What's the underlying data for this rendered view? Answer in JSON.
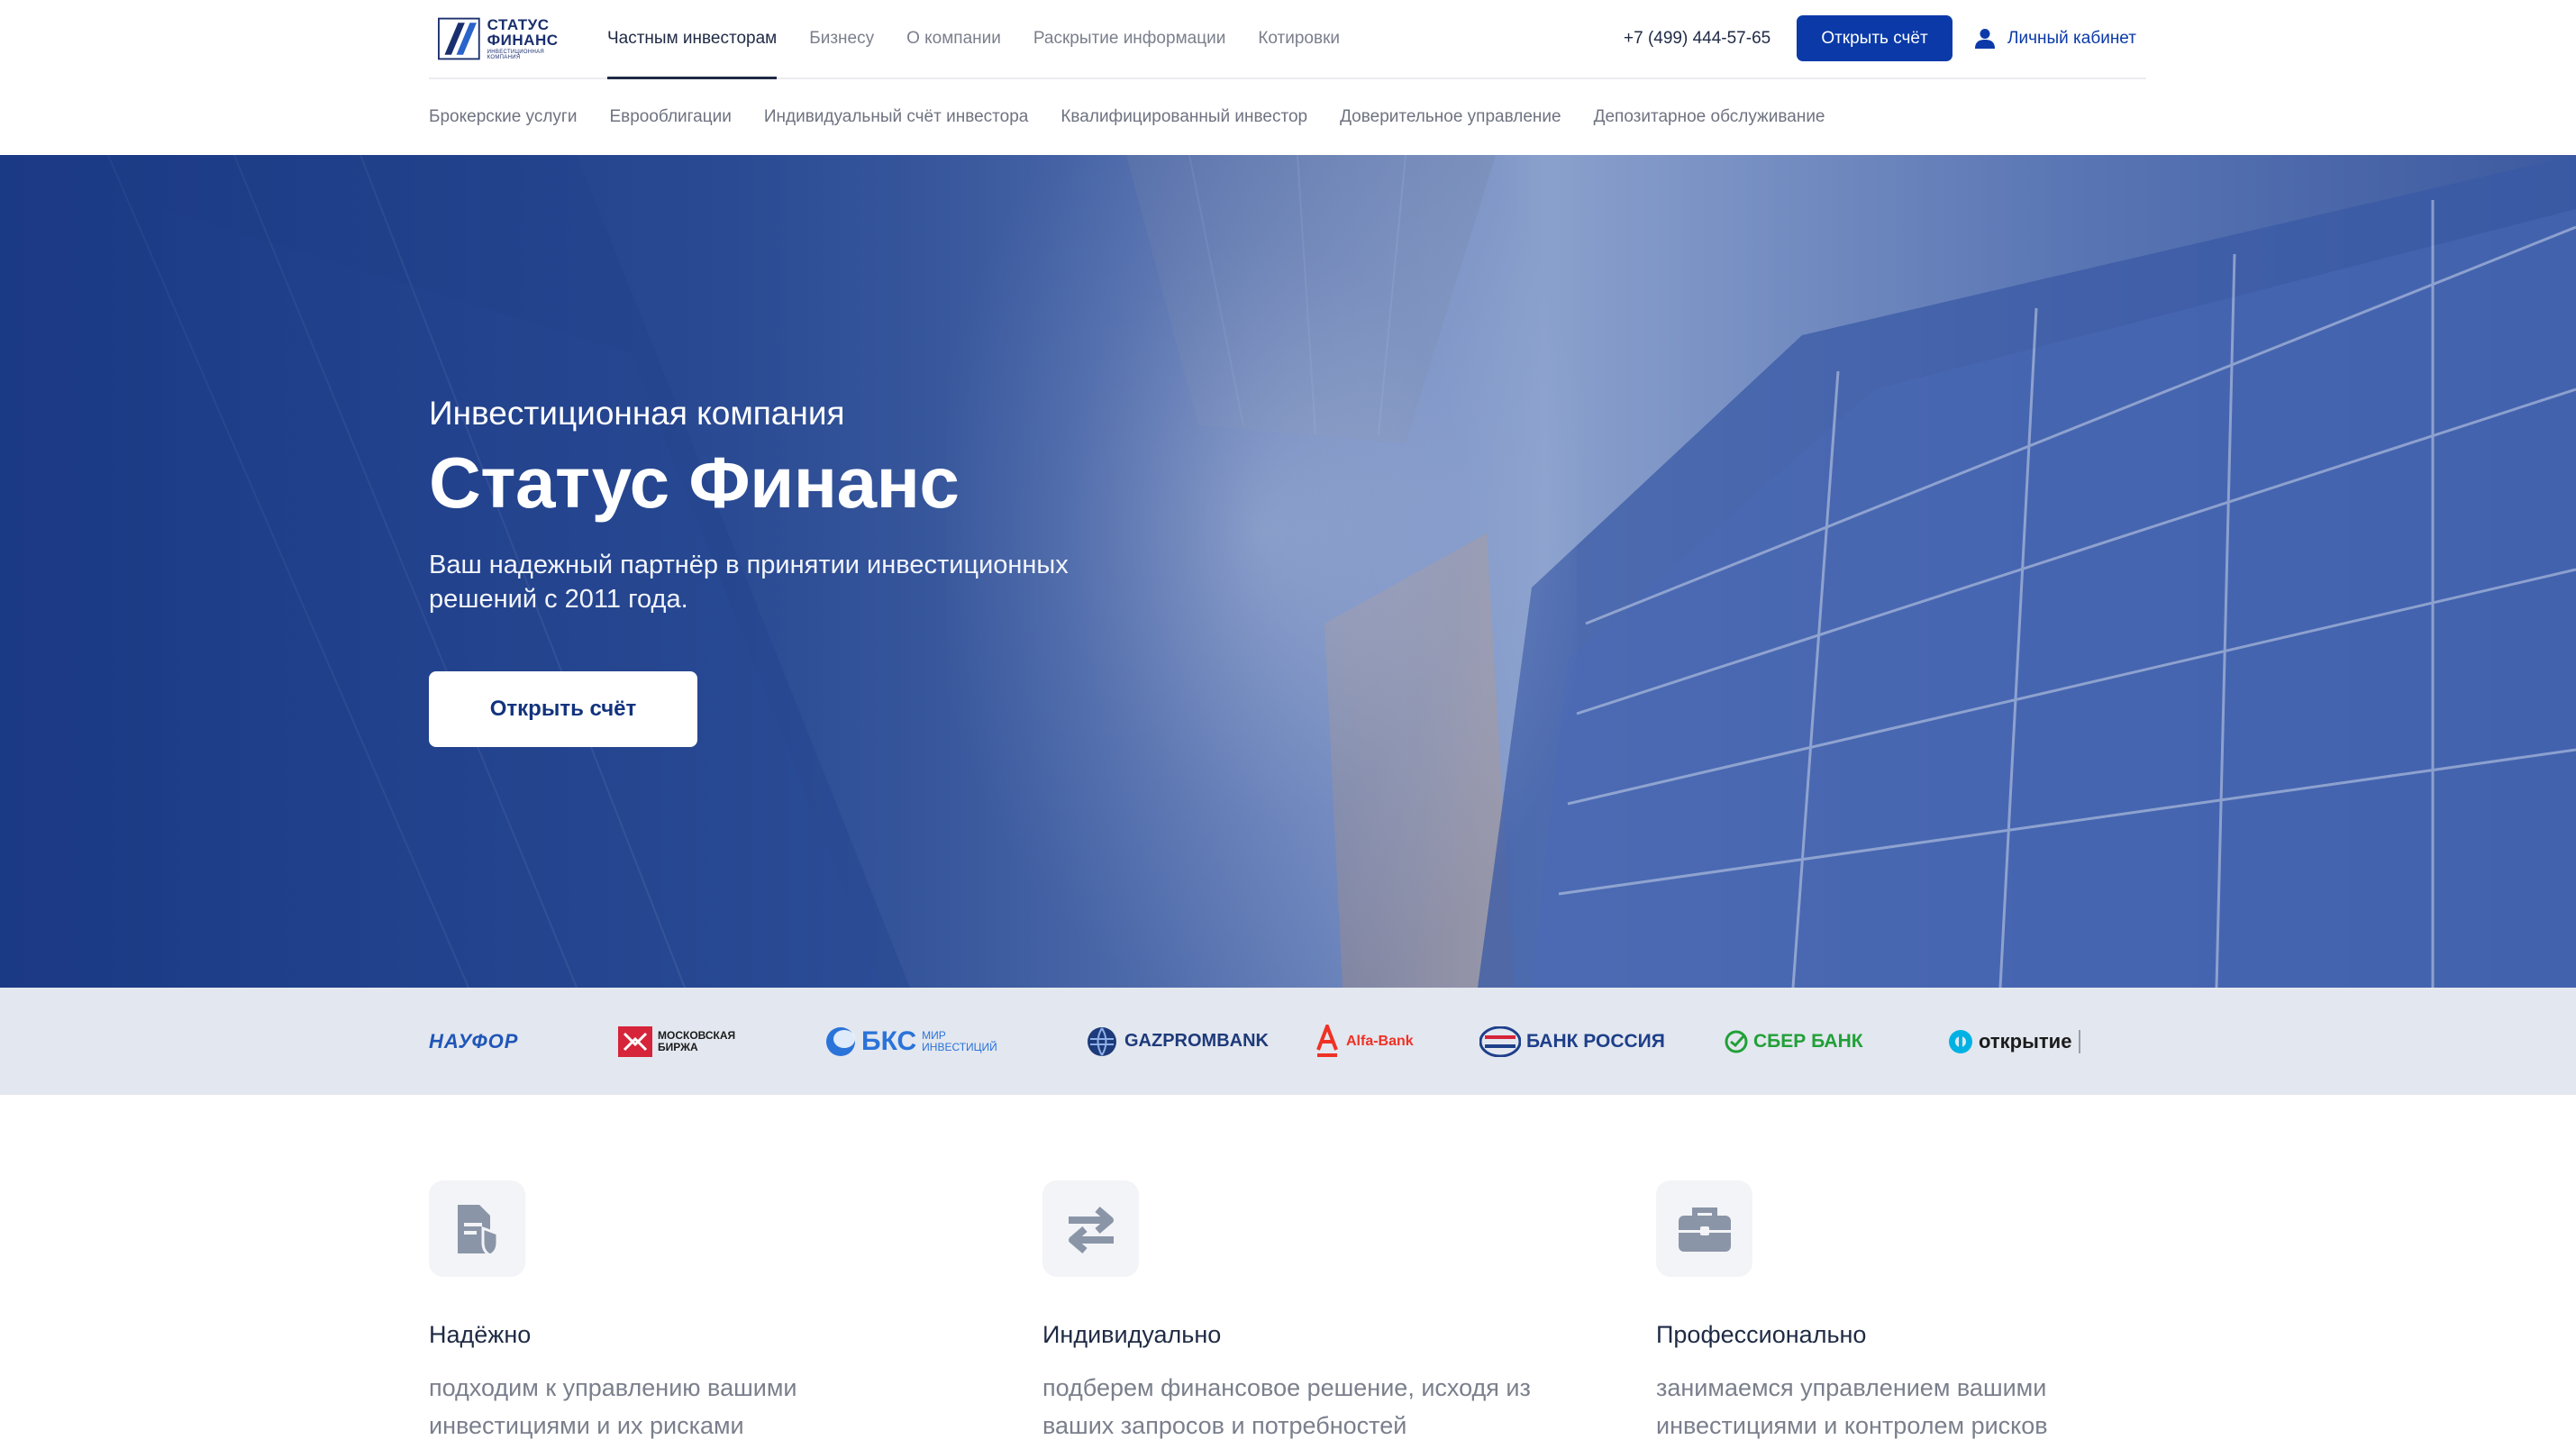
{
  "logo": {
    "line1": "СТАТУС",
    "line2": "ФИНАНС",
    "line3": "ИНВЕСТИЦИОННАЯ КОМПАНИЯ"
  },
  "nav": {
    "items": [
      {
        "label": "Частным инвесторам",
        "active": true
      },
      {
        "label": "Бизнесу"
      },
      {
        "label": "О компании"
      },
      {
        "label": "Раскрытие информации"
      },
      {
        "label": "Котировки"
      }
    ],
    "phone": "+7 (499) 444-57-65",
    "open_account": "Открыть счёт",
    "cabinet": "Личный кабинет"
  },
  "subnav": {
    "items": [
      "Брокерские услуги",
      "Еврооблигации",
      "Индивидуальный счёт инвестора",
      "Квалифицированный инвестор",
      "Доверительное управление",
      "Депозитарное обслуживание"
    ]
  },
  "hero": {
    "subtitle": "Инвестиционная компания",
    "title": "Статус Финанс",
    "text": "Ваш надежный партнёр  в принятии инвестиционных решений с 2011 года.",
    "button": "Открыть счёт"
  },
  "partners": [
    {
      "name": "НАУФОР",
      "color": "#1f56b8"
    },
    {
      "name": "МОСКОВСКАЯ БИРЖА",
      "color": "#d6243a"
    },
    {
      "name": "БКС",
      "sub": "МИР ИНВЕСТИЦИЙ",
      "color": "#2a73d9"
    },
    {
      "name": "GAZPROMBANK",
      "color": "#1d3a7a"
    },
    {
      "name": "Alfa-Bank",
      "color": "#ef3124"
    },
    {
      "name": "БАНК РОССИЯ",
      "color": "#1e3f8a"
    },
    {
      "name": "СБЕР БАНК",
      "color": "#21a038"
    },
    {
      "name": "открытие",
      "color": "#00b2e3"
    }
  ],
  "features": [
    {
      "icon": "document-shield-icon",
      "title": "Надёжно",
      "text": "подходим к управлению вашими инвестициями и их рисками"
    },
    {
      "icon": "exchange-arrows-icon",
      "title": "Индивидуально",
      "text": "подберем финансовое решение, исходя из ваших запросов и потребностей"
    },
    {
      "icon": "briefcase-icon",
      "title": "Профессионально",
      "text": "занимаемся управлением вашими инвестициями и контролем рисков"
    }
  ],
  "colors": {
    "brand": "#0b3aa8",
    "text": "#1f2a44",
    "muted": "#7a7f8c"
  }
}
